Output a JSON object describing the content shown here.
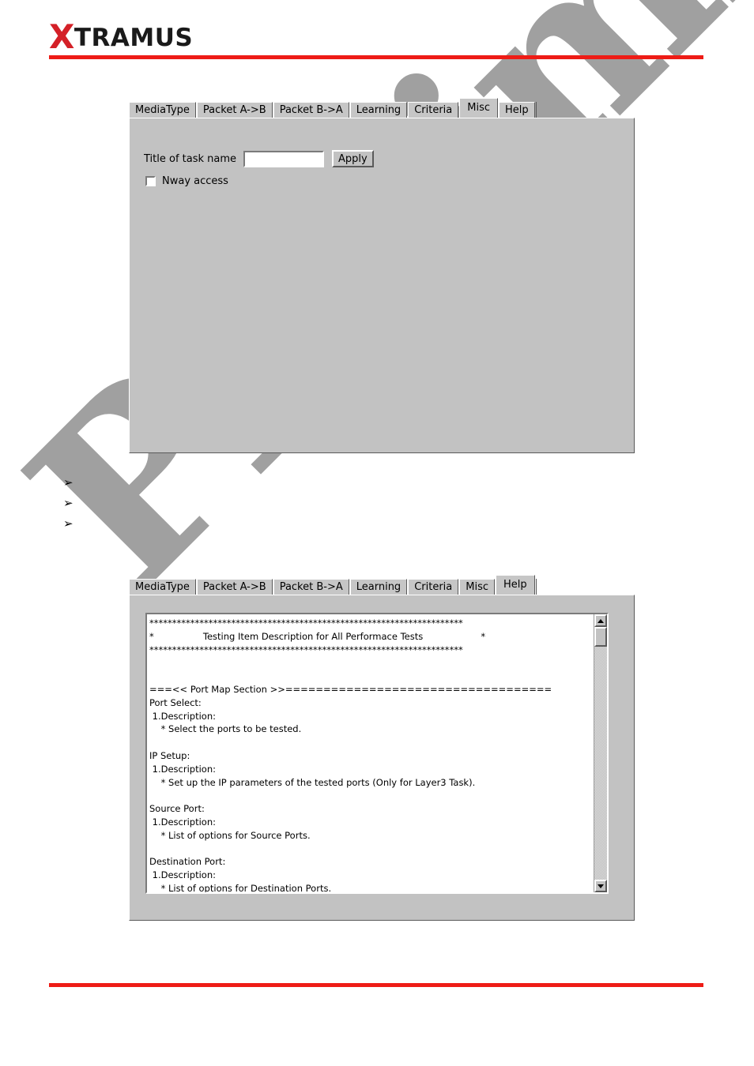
{
  "header": {
    "logo_x": "X",
    "logo_rest": "TRAMUS",
    "brand_color": "#d42027",
    "rule_color": "#ee1c16"
  },
  "watermark": {
    "text": "Preliminary",
    "color": "#a0a0a0"
  },
  "panel_misc": {
    "tabs": [
      {
        "label": "MediaType",
        "active": false
      },
      {
        "label": "Packet A->B",
        "active": false
      },
      {
        "label": "Packet B->A",
        "active": false
      },
      {
        "label": "Learning",
        "active": false
      },
      {
        "label": "Criteria",
        "active": false
      },
      {
        "label": "Misc",
        "active": true
      },
      {
        "label": "Help",
        "active": false
      }
    ],
    "title_label": "Title of task name",
    "title_value": "",
    "title_placeholder": "",
    "apply_label": "Apply",
    "nway_label": "Nway access",
    "nway_checked": false
  },
  "bullets": [
    {
      "glyph": "➢",
      "text": ""
    },
    {
      "glyph": "➢",
      "text": ""
    },
    {
      "glyph": "➢",
      "text": ""
    }
  ],
  "panel_help": {
    "tabs": [
      {
        "label": "MediaType",
        "active": false
      },
      {
        "label": "Packet A->B",
        "active": false
      },
      {
        "label": "Packet B->A",
        "active": false
      },
      {
        "label": "Learning",
        "active": false
      },
      {
        "label": "Criteria",
        "active": false
      },
      {
        "label": "Misc",
        "active": false
      },
      {
        "label": "Help",
        "active": true
      }
    ],
    "help_text": "*********************************************************************\n*                 Testing Item Description for All Performace Tests                    *\n*********************************************************************\n\n\n===<< Port Map Section >>===================================\nPort Select:\n 1.Description:\n    * Select the ports to be tested.\n\nIP Setup:\n 1.Description:\n    * Set up the IP parameters of the tested ports (Only for Layer3 Task).\n\nSource Port:\n 1.Description:\n    * List of options for Source Ports.\n\nDestination Port:\n 1.Description:\n    * List of options for Destination Ports.",
    "scrollbar": {
      "up_arrow": "scroll-up",
      "down_arrow": "scroll-down",
      "thumb_position_percent": 0
    }
  }
}
